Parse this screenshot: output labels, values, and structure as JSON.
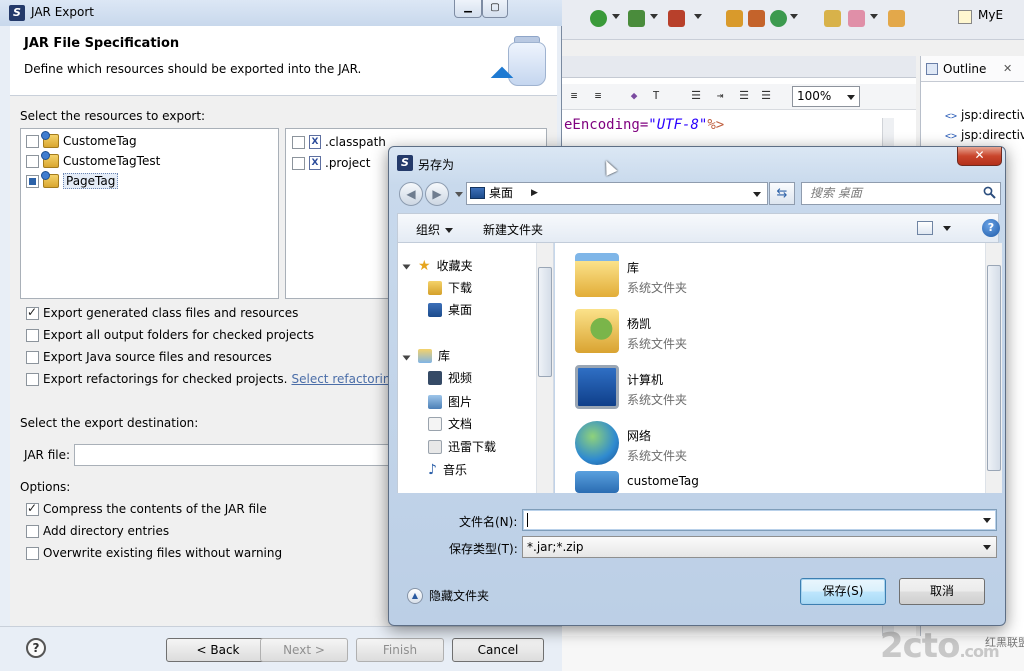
{
  "ide": {
    "code_line": {
      "prefix": "eEncoding=",
      "value": "\"UTF-8\"",
      "suffix": "%>"
    },
    "zoom": "100%",
    "outline": {
      "title": "Outline",
      "close": "✕",
      "items": [
        "jsp:directiv",
        "jsp:directiv"
      ]
    },
    "top_right_label": "MyE",
    "watermark": "2cto",
    "watermark_suffix": ".com",
    "watermark_tagline": "红黑联盟"
  },
  "wizard": {
    "window_title": "JAR Export",
    "header_title": "JAR File Specification",
    "header_desc": "Define which resources should be exported into the JAR.",
    "resources_label": "Select the resources to export:",
    "projects": [
      {
        "name": "CustomeTag",
        "state": "unchecked"
      },
      {
        "name": "CustomeTagTest",
        "state": "unchecked"
      },
      {
        "name": "PageTag",
        "state": "partial"
      }
    ],
    "files": [
      {
        "name": ".classpath",
        "icon": "X"
      },
      {
        "name": ".project",
        "icon": "X"
      }
    ],
    "options_export": [
      {
        "label": "Export generated class files and resources",
        "checked": true
      },
      {
        "label": "Export all output folders for checked projects",
        "checked": false
      },
      {
        "label": "Export Java source files and resources",
        "checked": false
      },
      {
        "label": "Export refactorings for checked projects.",
        "checked": false,
        "link": "Select refactoring"
      }
    ],
    "destination_label": "Select the export destination:",
    "jar_file_label": "JAR file:",
    "jar_file_value": "",
    "options_label": "Options:",
    "options": [
      {
        "label": "Compress the contents of the JAR file",
        "checked": true
      },
      {
        "label": "Add directory entries",
        "checked": false
      },
      {
        "label": "Overwrite existing files without warning",
        "checked": false
      }
    ],
    "buttons": {
      "help": "?",
      "back": "< Back",
      "next": "Next >",
      "finish": "Finish",
      "cancel": "Cancel"
    }
  },
  "saveas": {
    "title": "另存为",
    "close": "✕",
    "location": "桌面",
    "search_placeholder": "搜索 桌面",
    "organize": "组织",
    "new_folder": "新建文件夹",
    "nav": {
      "favorites": "收藏夹",
      "downloads": "下载",
      "desktop": "桌面",
      "libraries": "库",
      "videos": "视频",
      "pictures": "图片",
      "documents": "文档",
      "thunder": "迅雷下载",
      "music": "音乐"
    },
    "items": [
      {
        "name": "库",
        "type": "系统文件夹"
      },
      {
        "name": "杨凯",
        "type": "系统文件夹"
      },
      {
        "name": "计算机",
        "type": "系统文件夹"
      },
      {
        "name": "网络",
        "type": "系统文件夹"
      },
      {
        "name": "customeTag",
        "type": ""
      }
    ],
    "filename_label": "文件名(N):",
    "filename_value": "",
    "filetype_label": "保存类型(T):",
    "filetype_value": "*.jar;*.zip",
    "hide_folders": "隐藏文件夹",
    "save_button": "保存(S)",
    "cancel_button": "取消"
  },
  "colors": {
    "accent": "#3c7fb1",
    "close_red": "#c9452c",
    "link": "#4b6ea8"
  }
}
